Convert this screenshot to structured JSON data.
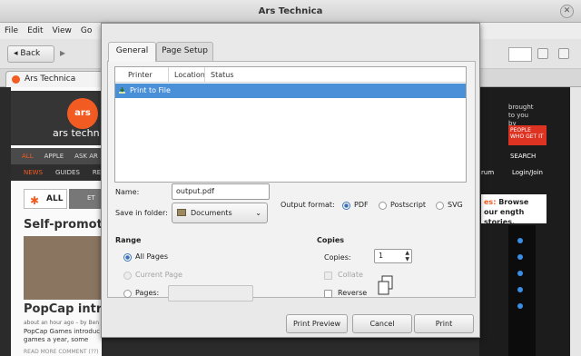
{
  "window": {
    "title": "Ars Technica",
    "close_glyph": "✕"
  },
  "menubar": [
    "File",
    "Edit",
    "View",
    "Go",
    "Bo"
  ],
  "navbar": {
    "back_label": "Back",
    "back_icon": "◂",
    "forward_icon": "▸"
  },
  "tab": {
    "label": "Ars Technica",
    "close_glyph": "✕"
  },
  "page": {
    "logo_badge": "ars",
    "logo_text": "ars techn",
    "categories": [
      "ALL",
      "APPLE",
      "ASK AR"
    ],
    "sections": [
      "NEWS",
      "GUIDES",
      "REV"
    ],
    "filter_all": "ALL",
    "filter_other": "ET",
    "headline1": "Self-promotio",
    "headline2": "PopCap introd",
    "meta": "about an hour ago – by Ben",
    "snippet": "PopCap Games introduc games a year, some including mature content. The first game will be a free iOS title called Unpleasant Horse.",
    "read_more": "READ MORE     COMMENT (??)",
    "brought_by": "brought to you by",
    "sponsor": "PEOPLE WHO GET IT",
    "search_label": "SEARCH",
    "right_menu_a": "rum",
    "login": "Login/Join",
    "promo_hl": "es:",
    "promo": "Browse our ength stories."
  },
  "dialog": {
    "tabs": {
      "general": "General",
      "page_setup": "Page Setup"
    },
    "printer_list": {
      "columns": [
        "Printer",
        "Location",
        "Status"
      ],
      "rows": [
        {
          "name": "Print to File",
          "location": "",
          "status": "",
          "selected": true
        }
      ]
    },
    "name_label": "Name:",
    "name_value": "output.pdf",
    "folder_label": "Save in folder:",
    "folder_value": "Documents",
    "format_label": "Output format:",
    "formats": [
      {
        "label": "PDF",
        "selected": true
      },
      {
        "label": "Postscript",
        "selected": false
      },
      {
        "label": "SVG",
        "selected": false
      }
    ],
    "range": {
      "title": "Range",
      "all_pages": "All Pages",
      "current_page": "Current Page",
      "pages": "Pages:",
      "pages_value": ""
    },
    "copies": {
      "title": "Copies",
      "label": "Copies:",
      "value": "1",
      "collate": "Collate",
      "reverse": "Reverse"
    },
    "buttons": {
      "preview": "Print Preview",
      "cancel": "Cancel",
      "print": "Print"
    }
  }
}
